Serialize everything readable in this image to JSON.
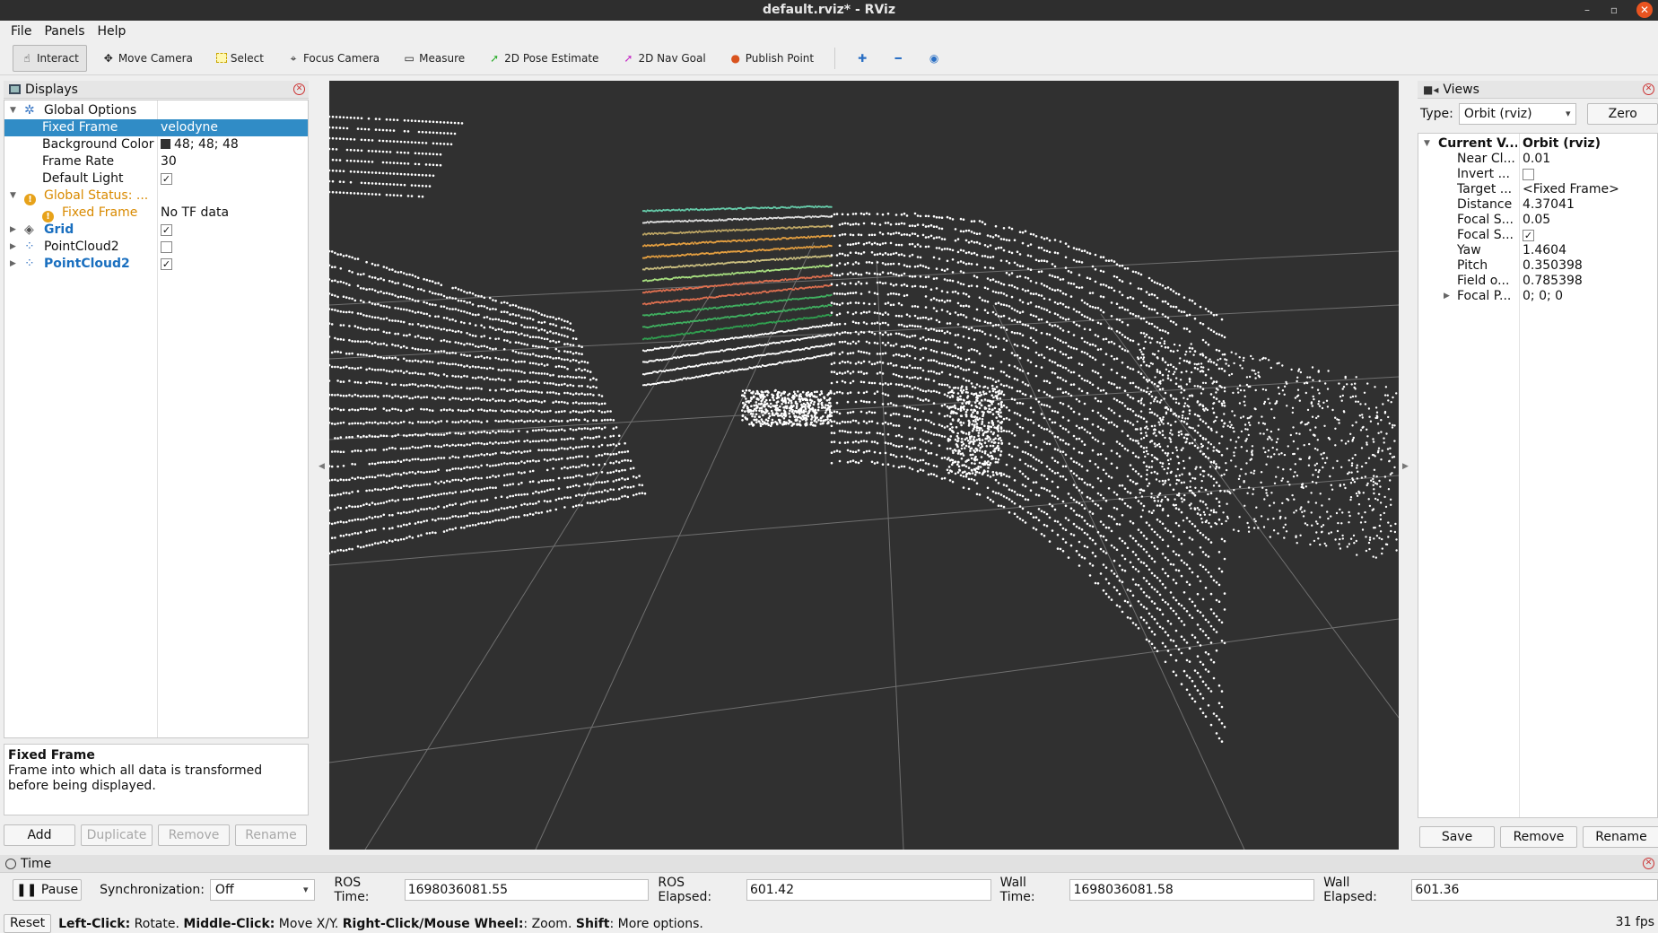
{
  "window": {
    "title": "default.rviz* - RViz"
  },
  "menu": [
    "File",
    "Panels",
    "Help"
  ],
  "toolbar": {
    "tools": [
      {
        "label": "Interact",
        "icon": "hand-icon"
      },
      {
        "label": "Move Camera",
        "icon": "move-camera-icon"
      },
      {
        "label": "Select",
        "icon": "select-icon"
      },
      {
        "label": "Focus Camera",
        "icon": "focus-camera-icon"
      },
      {
        "label": "Measure",
        "icon": "ruler-icon"
      },
      {
        "label": "2D Pose Estimate",
        "icon": "green-arrow-icon"
      },
      {
        "label": "2D Nav Goal",
        "icon": "pink-arrow-icon"
      },
      {
        "label": "Publish Point",
        "icon": "map-pin-icon"
      }
    ]
  },
  "displays": {
    "title": "Displays",
    "global_options": "Global Options",
    "fixed_frame_label": "Fixed Frame",
    "fixed_frame_value": "velodyne",
    "bg_label": "Background Color",
    "bg_value": "48; 48; 48",
    "bg_color": "#303030",
    "frame_rate_label": "Frame Rate",
    "frame_rate_value": "30",
    "default_light_label": "Default Light",
    "global_status": "Global Status: ...",
    "status_fixed_frame": "Fixed Frame",
    "status_value": "No TF data",
    "grid": "Grid",
    "pc1": "PointCloud2",
    "pc2": "PointCloud2",
    "desc_title": "Fixed Frame",
    "desc_text": "Frame into which all data is transformed before being displayed.",
    "buttons": {
      "add": "Add",
      "duplicate": "Duplicate",
      "remove": "Remove",
      "rename": "Rename"
    }
  },
  "views": {
    "title": "Views",
    "type_label": "Type:",
    "type_value": "Orbit (rviz)",
    "zero": "Zero",
    "current_label": "Current V...",
    "current_value": "Orbit (rviz)",
    "props": [
      {
        "k": "Near Cl...",
        "v": "0.01"
      },
      {
        "k": "Invert ...",
        "v": ""
      },
      {
        "k": "Target ...",
        "v": "<Fixed Frame>"
      },
      {
        "k": "Distance",
        "v": "4.37041"
      },
      {
        "k": "Focal S...",
        "v": "0.05"
      },
      {
        "k": "Focal S...",
        "v": ""
      },
      {
        "k": "Yaw",
        "v": "1.4604"
      },
      {
        "k": "Pitch",
        "v": "0.350398"
      },
      {
        "k": "Field o...",
        "v": "0.785398"
      },
      {
        "k": "Focal P...",
        "v": "0; 0; 0"
      }
    ],
    "buttons": {
      "save": "Save",
      "remove": "Remove",
      "rename": "Rename"
    }
  },
  "time": {
    "title": "Time",
    "pause": "Pause",
    "sync_label": "Synchronization:",
    "sync_value": "Off",
    "ros_time_label": "ROS Time:",
    "ros_time": "1698036081.55",
    "ros_elapsed_label": "ROS Elapsed:",
    "ros_elapsed": "601.42",
    "wall_time_label": "Wall Time:",
    "wall_time": "1698036081.58",
    "wall_elapsed_label": "Wall Elapsed:",
    "wall_elapsed": "601.36"
  },
  "status": {
    "reset": "Reset",
    "help_lc": "Left-Click:",
    "help_lc_t": " Rotate. ",
    "help_mc": "Middle-Click:",
    "help_mc_t": " Move X/Y. ",
    "help_rc": "Right-Click/Mouse Wheel:",
    "help_rc_t": ": Zoom. ",
    "help_sh": "Shift",
    "help_sh_t": ": More options.",
    "fps": "31 fps"
  }
}
